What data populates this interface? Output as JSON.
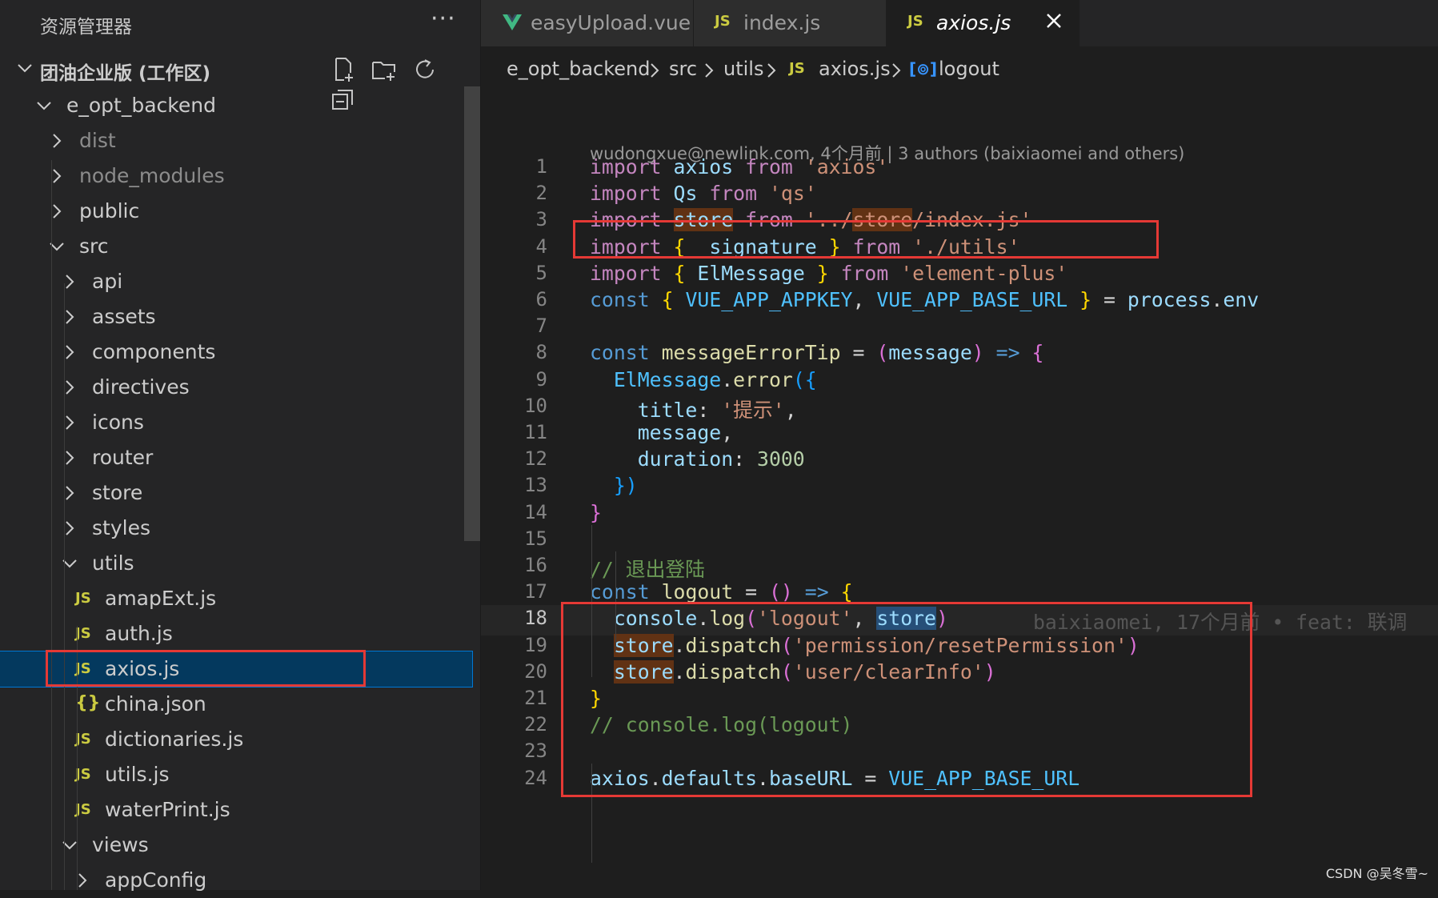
{
  "sidebar": {
    "title": "资源管理器",
    "more": "···",
    "workspace": "团油企业版 (工作区)",
    "actions": [
      "new-file-icon",
      "new-folder-icon",
      "refresh-icon",
      "collapse-all-icon"
    ],
    "tree": [
      {
        "label": "e_opt_backend",
        "type": "folder-open",
        "depth": 0
      },
      {
        "label": "dist",
        "type": "folder",
        "depth": 1,
        "dim": true
      },
      {
        "label": "node_modules",
        "type": "folder",
        "depth": 1,
        "dim": true
      },
      {
        "label": "public",
        "type": "folder",
        "depth": 1
      },
      {
        "label": "src",
        "type": "folder-open",
        "depth": 1
      },
      {
        "label": "api",
        "type": "folder",
        "depth": 2
      },
      {
        "label": "assets",
        "type": "folder",
        "depth": 2
      },
      {
        "label": "components",
        "type": "folder",
        "depth": 2
      },
      {
        "label": "directives",
        "type": "folder",
        "depth": 2
      },
      {
        "label": "icons",
        "type": "folder",
        "depth": 2
      },
      {
        "label": "router",
        "type": "folder",
        "depth": 2
      },
      {
        "label": "store",
        "type": "folder",
        "depth": 2
      },
      {
        "label": "styles",
        "type": "folder",
        "depth": 2
      },
      {
        "label": "utils",
        "type": "folder-open",
        "depth": 2
      },
      {
        "label": "amapExt.js",
        "type": "js",
        "depth": 3
      },
      {
        "label": "auth.js",
        "type": "js",
        "depth": 3
      },
      {
        "label": "axios.js",
        "type": "js",
        "depth": 3,
        "selected": true
      },
      {
        "label": "china.json",
        "type": "json",
        "depth": 3
      },
      {
        "label": "dictionaries.js",
        "type": "js",
        "depth": 3
      },
      {
        "label": "utils.js",
        "type": "js",
        "depth": 3
      },
      {
        "label": "waterPrint.js",
        "type": "js",
        "depth": 3
      },
      {
        "label": "views",
        "type": "folder-open",
        "depth": 2
      },
      {
        "label": "appConfig",
        "type": "folder",
        "depth": 3
      }
    ]
  },
  "tabs": [
    {
      "label": "easyUpload.vue",
      "icon": "vue-icon"
    },
    {
      "label": "index.js",
      "icon": "js-icon"
    },
    {
      "label": "axios.js",
      "icon": "js-icon",
      "active": true
    }
  ],
  "breadcrumb": {
    "items": [
      "e_opt_backend",
      "src",
      "utils",
      "axios.js",
      "logout"
    ],
    "js_badge": "JS",
    "symbol_icon": "[⊚]"
  },
  "editor": {
    "codelens": "wudongxue@newlink.com, 4个月前 | 3 authors (baixiaomei and others)",
    "current_line": 18,
    "blame": "baixiaomei, 17个月前 • feat: 联调",
    "lines": [
      {
        "n": "1",
        "tokens": [
          [
            "kw",
            "import"
          ],
          [
            "op",
            " "
          ],
          [
            "var",
            "axios"
          ],
          [
            "op",
            " "
          ],
          [
            "kw",
            "from"
          ],
          [
            "op",
            " "
          ],
          [
            "str",
            "'axios'"
          ]
        ]
      },
      {
        "n": "2",
        "tokens": [
          [
            "kw",
            "import"
          ],
          [
            "op",
            " "
          ],
          [
            "var",
            "Qs"
          ],
          [
            "op",
            " "
          ],
          [
            "kw",
            "from"
          ],
          [
            "op",
            " "
          ],
          [
            "str",
            "'qs'"
          ]
        ]
      },
      {
        "n": "3",
        "tokens": [
          [
            "kw",
            "import"
          ],
          [
            "op",
            " "
          ],
          [
            "var hl",
            "store"
          ],
          [
            "op",
            " "
          ],
          [
            "kw",
            "from"
          ],
          [
            "op",
            " "
          ],
          [
            "str",
            "'../"
          ],
          [
            "str hl",
            "store"
          ],
          [
            "str",
            "/index.js'"
          ]
        ]
      },
      {
        "n": "4",
        "tokens": [
          [
            "kw",
            "import"
          ],
          [
            "op",
            " "
          ],
          [
            "p1",
            "{"
          ],
          [
            "op",
            " "
          ],
          [
            "var",
            "_signature"
          ],
          [
            "op",
            " "
          ],
          [
            "p1",
            "}"
          ],
          [
            "op",
            " "
          ],
          [
            "kw",
            "from"
          ],
          [
            "op",
            " "
          ],
          [
            "str",
            "'./utils'"
          ]
        ]
      },
      {
        "n": "5",
        "tokens": [
          [
            "kw",
            "import"
          ],
          [
            "op",
            " "
          ],
          [
            "p1",
            "{"
          ],
          [
            "op",
            " "
          ],
          [
            "var",
            "ElMessage"
          ],
          [
            "op",
            " "
          ],
          [
            "p1",
            "}"
          ],
          [
            "op",
            " "
          ],
          [
            "kw",
            "from"
          ],
          [
            "op",
            " "
          ],
          [
            "str",
            "'element-plus'"
          ]
        ]
      },
      {
        "n": "6",
        "tokens": [
          [
            "kw2",
            "const"
          ],
          [
            "op",
            " "
          ],
          [
            "p1",
            "{"
          ],
          [
            "op",
            " "
          ],
          [
            "cst",
            "VUE_APP_APPKEY"
          ],
          [
            "op",
            ", "
          ],
          [
            "cst",
            "VUE_APP_BASE_URL"
          ],
          [
            "op",
            " "
          ],
          [
            "p1",
            "}"
          ],
          [
            "op",
            " = "
          ],
          [
            "var",
            "process"
          ],
          [
            "op",
            "."
          ],
          [
            "var",
            "env"
          ]
        ]
      },
      {
        "n": "7",
        "tokens": []
      },
      {
        "n": "8",
        "tokens": [
          [
            "kw2",
            "const"
          ],
          [
            "op",
            " "
          ],
          [
            "fn",
            "messageErrorTip"
          ],
          [
            "op",
            " = "
          ],
          [
            "p2",
            "("
          ],
          [
            "var",
            "message"
          ],
          [
            "p2",
            ")"
          ],
          [
            "op",
            " "
          ],
          [
            "kw2",
            "=>"
          ],
          [
            "op",
            " "
          ],
          [
            "p2",
            "{"
          ]
        ]
      },
      {
        "n": "9",
        "tokens": [
          [
            "op",
            "  "
          ],
          [
            "cst",
            "ElMessage"
          ],
          [
            "op",
            "."
          ],
          [
            "fn",
            "error"
          ],
          [
            "p3",
            "({"
          ]
        ]
      },
      {
        "n": "10",
        "tokens": [
          [
            "op",
            "    "
          ],
          [
            "var",
            "title"
          ],
          [
            "op",
            ": "
          ],
          [
            "str",
            "'提示'"
          ],
          [
            "op",
            ","
          ]
        ]
      },
      {
        "n": "11",
        "tokens": [
          [
            "op",
            "    "
          ],
          [
            "var",
            "message"
          ],
          [
            "op",
            ","
          ]
        ]
      },
      {
        "n": "12",
        "tokens": [
          [
            "op",
            "    "
          ],
          [
            "var",
            "duration"
          ],
          [
            "op",
            ": "
          ],
          [
            "num",
            "3000"
          ]
        ]
      },
      {
        "n": "13",
        "tokens": [
          [
            "op",
            "  "
          ],
          [
            "p3",
            "})"
          ]
        ]
      },
      {
        "n": "14",
        "tokens": [
          [
            "p2",
            "}"
          ]
        ]
      },
      {
        "n": "15",
        "tokens": []
      },
      {
        "n": "16",
        "tokens": [
          [
            "cmt",
            "// 退出登陆"
          ]
        ]
      },
      {
        "n": "17",
        "tokens": [
          [
            "kw2",
            "const"
          ],
          [
            "op",
            " "
          ],
          [
            "fn",
            "logout"
          ],
          [
            "op",
            " = "
          ],
          [
            "p2",
            "()"
          ],
          [
            "op",
            " "
          ],
          [
            "kw2",
            "=>"
          ],
          [
            "op",
            " "
          ],
          [
            "p1",
            "{"
          ]
        ]
      },
      {
        "n": "18",
        "tokens": [
          [
            "op",
            "  "
          ],
          [
            "var",
            "console"
          ],
          [
            "op",
            "."
          ],
          [
            "fn",
            "log"
          ],
          [
            "p2",
            "("
          ],
          [
            "str",
            "'logout'"
          ],
          [
            "op",
            ", "
          ],
          [
            "var hl2",
            "store"
          ],
          [
            "p2",
            ")"
          ]
        ]
      },
      {
        "n": "19",
        "tokens": [
          [
            "op",
            "  "
          ],
          [
            "var hl",
            "store"
          ],
          [
            "op",
            "."
          ],
          [
            "fn",
            "dispatch"
          ],
          [
            "p2",
            "("
          ],
          [
            "str",
            "'permission/resetPermission'"
          ],
          [
            "p2",
            ")"
          ]
        ]
      },
      {
        "n": "20",
        "tokens": [
          [
            "op",
            "  "
          ],
          [
            "var hl",
            "store"
          ],
          [
            "op",
            "."
          ],
          [
            "fn",
            "dispatch"
          ],
          [
            "p2",
            "("
          ],
          [
            "str",
            "'user/clearInfo'"
          ],
          [
            "p2",
            ")"
          ]
        ]
      },
      {
        "n": "21",
        "tokens": [
          [
            "p1",
            "}"
          ]
        ]
      },
      {
        "n": "22",
        "tokens": [
          [
            "cmt",
            "// console.log(logout)"
          ]
        ]
      },
      {
        "n": "23",
        "tokens": []
      },
      {
        "n": "24",
        "tokens": [
          [
            "var",
            "axios"
          ],
          [
            "op",
            "."
          ],
          [
            "var",
            "defaults"
          ],
          [
            "op",
            "."
          ],
          [
            "var",
            "baseURL"
          ],
          [
            "op",
            " = "
          ],
          [
            "cst",
            "VUE_APP_BASE_URL"
          ]
        ]
      }
    ]
  },
  "watermark": "CSDN @吴冬雪~",
  "colors": {
    "highlight_box": "#e53935",
    "selection": "#04395e",
    "js_icon": "#cbcb41",
    "vue_icon": "#41b883"
  }
}
